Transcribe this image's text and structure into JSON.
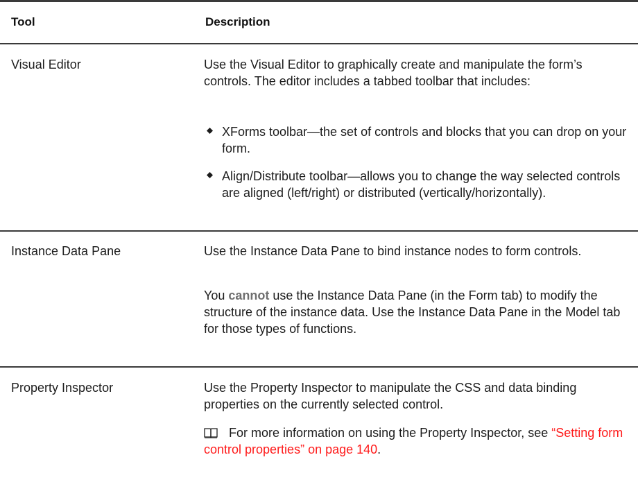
{
  "table": {
    "headers": {
      "tool": "Tool",
      "description": "Description"
    },
    "rows": [
      {
        "tool": "Visual Editor",
        "paragraphs": [
          "Use the Visual Editor to graphically create and manipulate the form’s controls. The editor includes a tabbed toolbar that includes:"
        ],
        "bullets": [
          "XForms toolbar—the set of controls and blocks that you can drop on your form.",
          "Align/Distribute toolbar—allows you to change the way selected controls are aligned (left/right) or distributed (vertically/horizontally)."
        ]
      },
      {
        "tool": "Instance Data Pane",
        "paragraphs": [
          "Use the Instance Data Pane to bind instance nodes to form controls."
        ],
        "p2_before": "You ",
        "p2_emph": "cannot",
        "p2_after": " use the Instance Data Pane (in the Form tab) to modify the structure of the instance data. Use the Instance Data Pane in the Model tab for those types of functions."
      },
      {
        "tool": "Property Inspector",
        "paragraphs": [
          "Use the Property Inspector to manipulate the CSS and data binding properties on the currently selected control."
        ],
        "note_icon": "book-icon",
        "note_text": "For more information on using the Property Inspector, see ",
        "note_link": "“Setting form control properties” on page 140",
        "note_end": "."
      }
    ]
  },
  "colors": {
    "rule": "#3a3a3a",
    "emphasis": "#6f6f6f",
    "link": "#ff1a1a"
  }
}
